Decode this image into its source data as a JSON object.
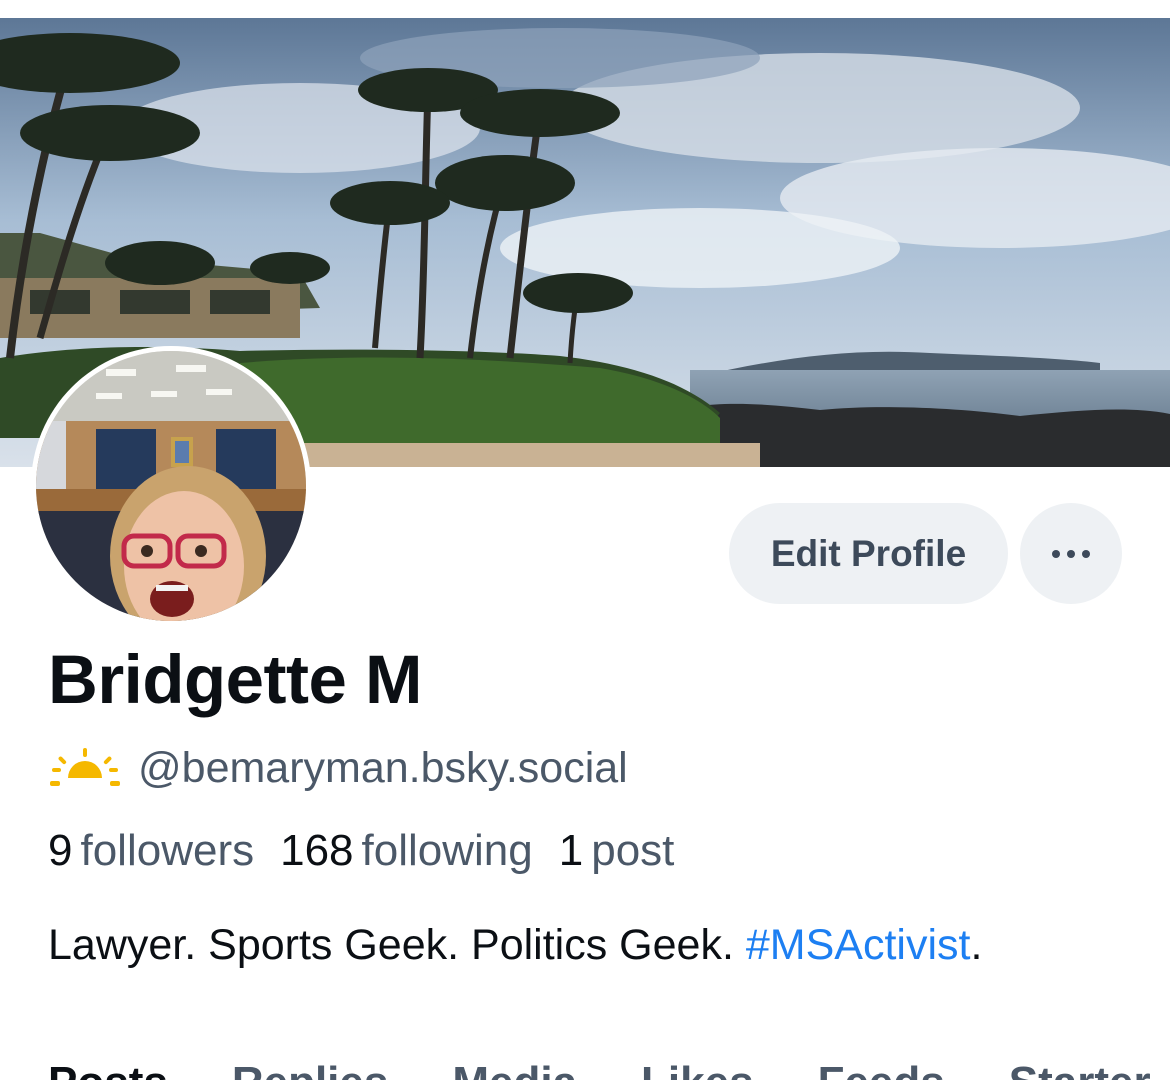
{
  "profile": {
    "display_name": "Bridgette M",
    "handle": "@bemaryman.bsky.social",
    "status_emoji": "sun-behind-horizon-icon",
    "bio_text": "Lawyer. Sports Geek. Politics Geek. ",
    "bio_hashtag": "#MSActivist",
    "bio_end": "."
  },
  "stats": {
    "followers_count": "9",
    "followers_label": "followers",
    "following_count": "168",
    "following_label": "following",
    "posts_count": "1",
    "posts_label": "post"
  },
  "actions": {
    "edit_profile_label": "Edit Profile",
    "more_icon": "ellipsis-icon"
  },
  "tabs": [
    {
      "label": "Posts"
    },
    {
      "label": "Replies"
    },
    {
      "label": "Media"
    },
    {
      "label": "Likes"
    },
    {
      "label": "Feeds"
    },
    {
      "label": "Starter"
    }
  ],
  "colors": {
    "link": "#1d7ff2",
    "muted_text": "#4b5868",
    "button_bg": "#eef1f4",
    "sun": "#f5b800"
  }
}
